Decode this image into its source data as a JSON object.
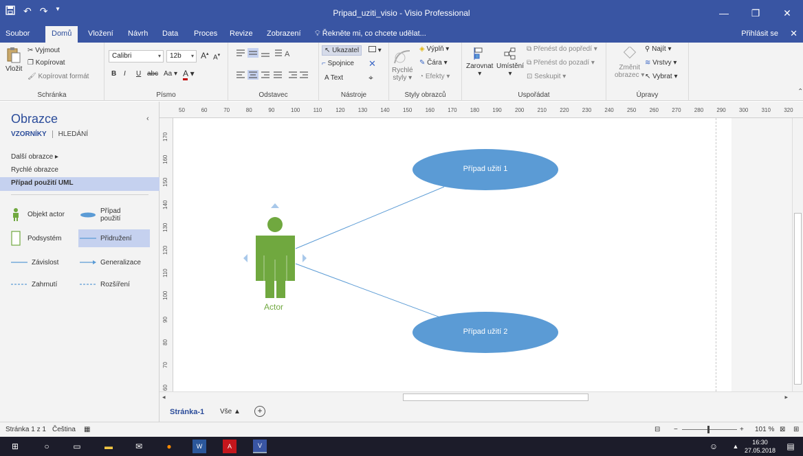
{
  "window": {
    "title": "Pripad_uziti_visio - Visio Professional",
    "minimize": "—",
    "restore": "❐",
    "close": "✕"
  },
  "quick_access": {
    "save": "💾",
    "undo": "↶",
    "redo": "↷",
    "customize": "≡"
  },
  "ribbon_tabs": [
    "Soubor",
    "Domů",
    "Vložení",
    "Návrh",
    "Data",
    "Proces",
    "Revize",
    "Zobrazení"
  ],
  "active_tab": "Domů",
  "tell_me": "Řekněte mi, co chcete udělat...",
  "sign_in": "Přihlásit se",
  "ribbon": {
    "clipboard": {
      "label": "Schránka",
      "paste": "Vložit",
      "cut": "Vyjmout",
      "copy": "Kopírovat",
      "format_painter": "Kopírovat formát"
    },
    "font": {
      "label": "Písmo",
      "font_name": "Calibri",
      "font_size": "12b",
      "bold": "B",
      "italic": "I",
      "underline": "U",
      "strike": "abc",
      "case": "Aa",
      "color": "A"
    },
    "paragraph": {
      "label": "Odstavec"
    },
    "tools": {
      "label": "Nástroje",
      "pointer": "Ukazatel",
      "connector": "Spojnice",
      "text": "Text"
    },
    "shape_styles": {
      "label": "Styly obrazců",
      "quick_styles_1": "Rychlé",
      "quick_styles_2": "styly",
      "fill": "Výplň",
      "line": "Čára",
      "effects": "Efekty"
    },
    "arrange": {
      "label": "Uspořádat",
      "align": "Zarovnat",
      "position": "Umístění",
      "bring_front": "Přenést do popředí",
      "send_back": "Přenést do pozadí",
      "group": "Seskupit"
    },
    "editing": {
      "label": "Úpravy",
      "change_shape_1": "Změnit",
      "change_shape_2": "obrazec",
      "find": "Najít",
      "layers": "Vrstvy",
      "select": "Vybrat"
    }
  },
  "shapes_pane": {
    "title": "Obrazce",
    "tab_stencils": "VZORNÍKY",
    "tab_search": "HLEDÁNÍ",
    "more_shapes": "Další obrazce",
    "quick_shapes": "Rychlé obrazce",
    "uml_stencil": "Případ použití UML",
    "items": {
      "actor": "Objekt actor",
      "use_case_1": "Případ",
      "use_case_2": "použití",
      "subsystem": "Podsystém",
      "association": "Přidružení",
      "dependency": "Závislost",
      "generalization": "Generalizace",
      "include": "Zahrnutí",
      "extend": "Rozšíření"
    }
  },
  "ruler": {
    "horizontal": [
      "50",
      "60",
      "70",
      "80",
      "90",
      "100",
      "110",
      "120",
      "130",
      "140",
      "150",
      "160",
      "170",
      "180",
      "190",
      "200",
      "210",
      "220",
      "230",
      "240",
      "250",
      "260",
      "270",
      "280",
      "290",
      "300",
      "310",
      "320"
    ],
    "vertical": [
      "170",
      "160",
      "150",
      "140",
      "130",
      "120",
      "110",
      "100",
      "90",
      "80",
      "70",
      "60"
    ]
  },
  "diagram": {
    "actor_label": "Actor",
    "use_case_1": "Případ užití 1",
    "use_case_2": "Případ užití 2",
    "colors": {
      "actor": "#70a83f",
      "use_case": "#5b9bd5",
      "line": "#5b9bd5"
    }
  },
  "page_tabs": {
    "page": "Stránka-1",
    "all": "Vše ▲",
    "add": "+"
  },
  "status": {
    "page": "Stránka 1 z 1",
    "language": "Čeština",
    "zoom": "101 %"
  },
  "taskbar": {
    "time": "16:30",
    "date": "27.05.2018"
  }
}
